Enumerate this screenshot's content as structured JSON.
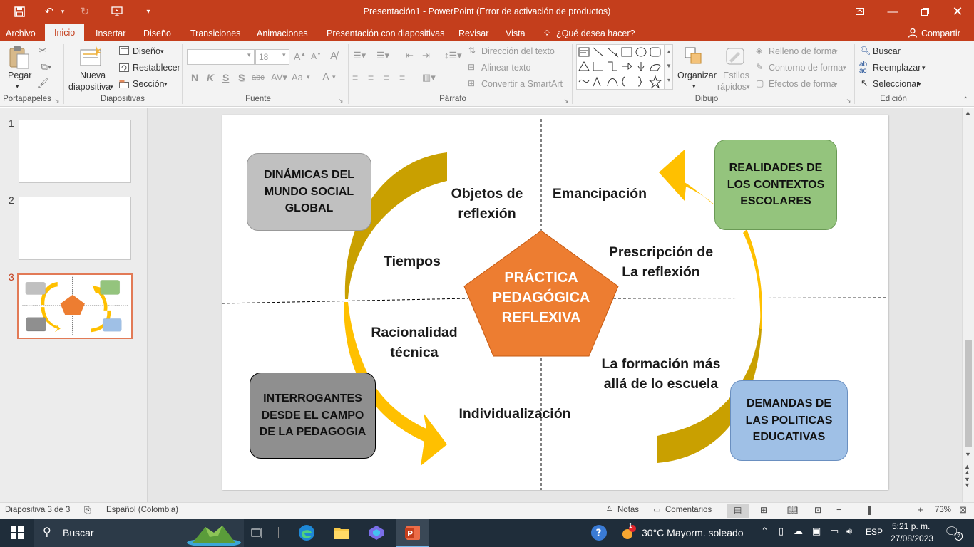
{
  "window": {
    "title": "Presentación1 - PowerPoint (Error de activación de productos)"
  },
  "tabs": [
    {
      "label": "Archivo"
    },
    {
      "label": "Inicio"
    },
    {
      "label": "Insertar"
    },
    {
      "label": "Diseño"
    },
    {
      "label": "Transiciones"
    },
    {
      "label": "Animaciones"
    },
    {
      "label": "Presentación con diapositivas"
    },
    {
      "label": "Revisar"
    },
    {
      "label": "Vista"
    }
  ],
  "tellme": "¿Qué desea hacer?",
  "share": "Compartir",
  "ribbon": {
    "clipboard": {
      "paste": "Pegar",
      "group": "Portapapeles"
    },
    "slides": {
      "new_line1": "Nueva",
      "new_line2": "diapositiva",
      "layout": "Diseño",
      "reset": "Restablecer",
      "section": "Sección",
      "group": "Diapositivas"
    },
    "font": {
      "size": "18",
      "bold": "N",
      "italic": "K",
      "underline": "S",
      "shadow": "S",
      "strike": "abc",
      "case": "Aa",
      "color": "A",
      "group": "Fuente"
    },
    "paragraph": {
      "direction": "Dirección del texto",
      "align": "Alinear texto",
      "smartart": "Convertir a SmartArt",
      "group": "Párrafo"
    },
    "drawing": {
      "arrange": "Organizar",
      "styles_line1": "Estilos",
      "styles_line2": "rápidos",
      "fill": "Relleno de forma",
      "outline": "Contorno de forma",
      "effects": "Efectos de forma",
      "group": "Dibujo"
    },
    "editing": {
      "find": "Buscar",
      "replace": "Reemplazar",
      "select": "Seleccionar",
      "group": "Edición"
    }
  },
  "thumbnails": [
    {
      "num": "1"
    },
    {
      "num": "2"
    },
    {
      "num": "3"
    }
  ],
  "slide": {
    "center": {
      "l1": "PRÁCTICA",
      "l2": "PEDAGÓGICA",
      "l3": "REFLEXIVA",
      "color": "#ed7d31"
    },
    "boxes": {
      "top_left": {
        "l1": "DINÁMICAS DEL",
        "l2": "MUNDO SOCIAL",
        "l3": "GLOBAL",
        "color": "#c0c0c0"
      },
      "top_right": {
        "l1": "REALIDADES DE",
        "l2": "LOS CONTEXTOS",
        "l3": "ESCOLARES",
        "color": "#94c47d"
      },
      "bottom_left": {
        "l1": "INTERROGANTES",
        "l2": "DESDE EL CAMPO",
        "l3": "DE LA PEDAGOGIA",
        "color": "#8f8f8f"
      },
      "bottom_right": {
        "l1": "DEMANDAS DE",
        "l2": "LAS POLITICAS",
        "l3": "EDUCATIVAS",
        "color": "#9fc0e6"
      }
    },
    "labels": {
      "objetos_l1": "Objetos de",
      "objetos_l2": "reflexión",
      "emancipacion": "Emancipación",
      "tiempos": "Tiempos",
      "prescripcion_l1": "Prescripción de",
      "prescripcion_l2": "La reflexión",
      "racionalidad_l1": "Racionalidad",
      "racionalidad_l2": "técnica",
      "formacion_l1": "La formación más",
      "formacion_l2": "allá de lo escuela",
      "individualizacion": "Individualización"
    },
    "arrow_color": "#ffc000"
  },
  "status": {
    "slide": "Diapositiva 3 de 3",
    "language": "Español (Colombia)",
    "notes": "Notas",
    "comments": "Comentarios",
    "zoom": "73%"
  },
  "taskbar": {
    "search": "Buscar",
    "weather": "30°C  Mayorm. soleado",
    "lang": "ESP",
    "time": "5:21 p. m.",
    "date": "27/08/2023",
    "notif_count": "2",
    "weather_badge": "1"
  }
}
